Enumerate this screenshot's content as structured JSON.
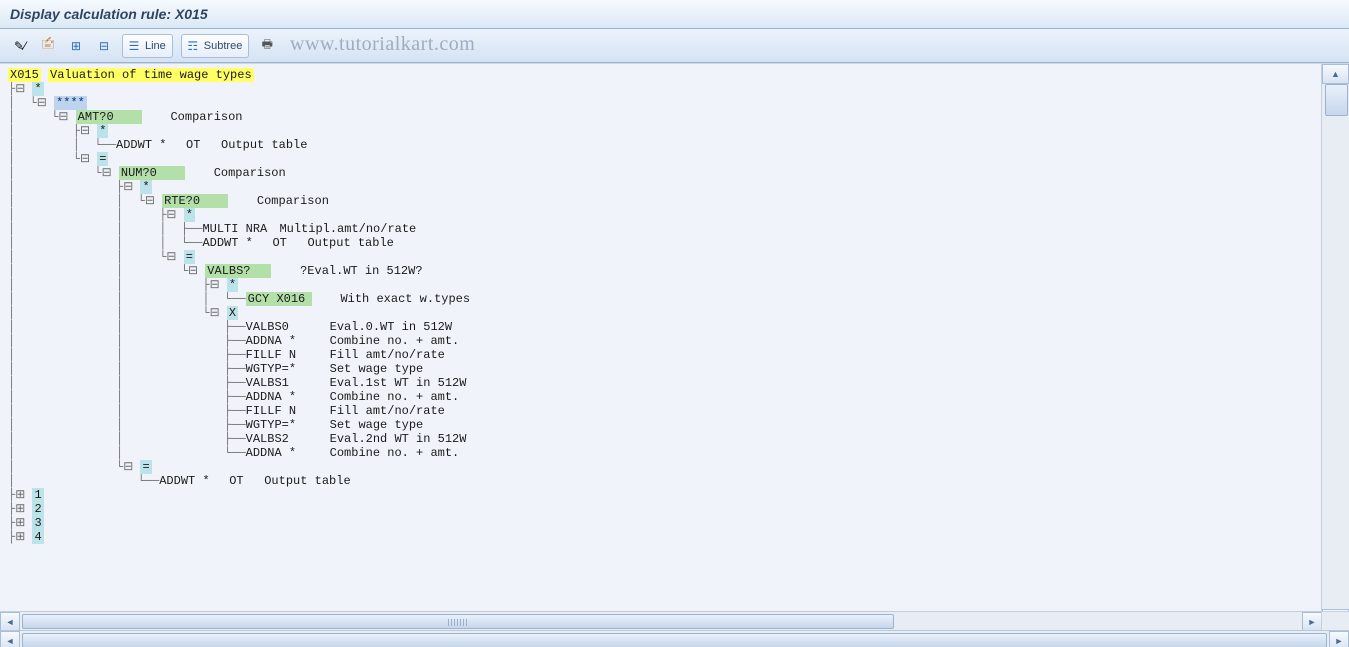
{
  "title": "Display calculation rule: X015",
  "watermark": "www.tutorialkart.com",
  "toolbar": {
    "line_label": "Line",
    "subtree_label": "Subtree"
  },
  "root": {
    "code": "X015",
    "text": "Valuation of time wage types"
  },
  "tree": {
    "r1": "*",
    "r2": "****",
    "r3_op": "AMT?0",
    "r3_desc": "Comparison",
    "r4": "*",
    "r5_op": "ADDWT *",
    "r5_par": "OT",
    "r5_desc": "Output table",
    "r6": "=",
    "r7_op": "NUM?0",
    "r7_desc": "Comparison",
    "r8": "*",
    "r9_op": "RTE?0",
    "r9_desc": "Comparison",
    "r10": "*",
    "r11_op": "MULTI NRA",
    "r11_desc": "Multipl.amt/no/rate",
    "r12_op": "ADDWT *",
    "r12_par": "OT",
    "r12_desc": "Output table",
    "r13": "=",
    "r14_op": "VALBS?",
    "r14_desc": "?Eval.WT in 512W?",
    "r15": "*",
    "r16_op": "GCY X016",
    "r16_desc": "With exact w.types",
    "r17": "X",
    "r18_op": "VALBS0",
    "r18_desc": "Eval.0.WT in 512W",
    "r19_op": "ADDNA *",
    "r19_desc": "Combine no. + amt.",
    "r20_op": "FILLF N",
    "r20_desc": "Fill amt/no/rate",
    "r21_op": "WGTYP=*",
    "r21_desc": "Set wage type",
    "r22_op": "VALBS1",
    "r22_desc": "Eval.1st WT in 512W",
    "r23_op": "ADDNA *",
    "r23_desc": "Combine no. + amt.",
    "r24_op": "FILLF N",
    "r24_desc": "Fill amt/no/rate",
    "r25_op": "WGTYP=*",
    "r25_desc": "Set wage type",
    "r26_op": "VALBS2",
    "r26_desc": "Eval.2nd WT in 512W",
    "r27_op": "ADDNA *",
    "r27_desc": "Combine no. + amt.",
    "r28": "=",
    "r29_op": "ADDWT *",
    "r29_par": "OT",
    "r29_desc": "Output table",
    "r30": "1",
    "r31": "2",
    "r32": "3",
    "r33": "4"
  }
}
